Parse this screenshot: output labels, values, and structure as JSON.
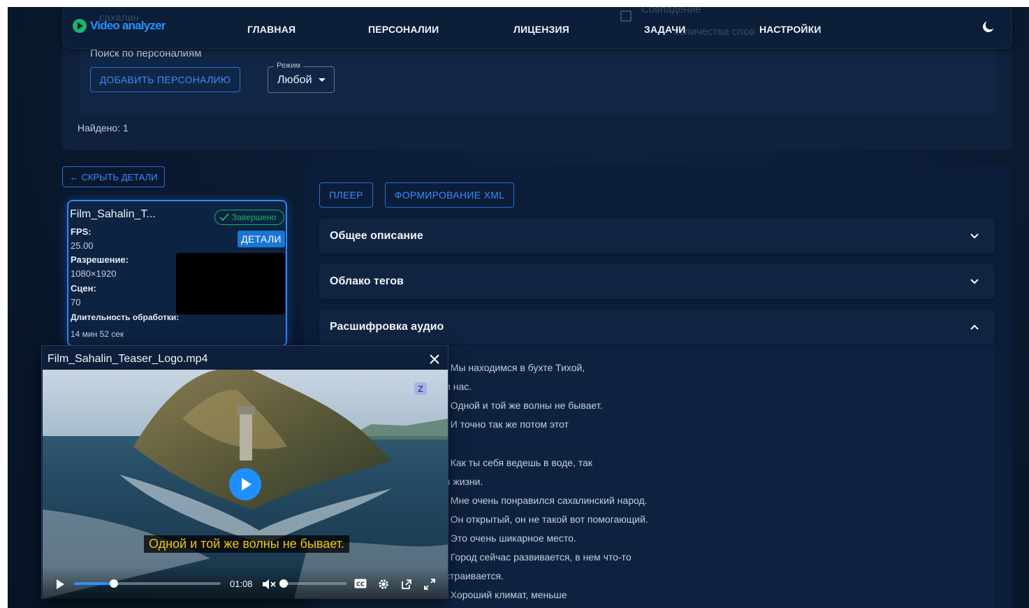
{
  "header": {
    "logo_text": "Video analyzer",
    "nav": [
      "ГЛАВНАЯ",
      "ПЕРСОНАЛИИ",
      "ЛИЦЕНЗИЯ",
      "ЗАДАЧИ",
      "НАСТРОЙКИ"
    ],
    "ghost_search_value": "сахалин",
    "ghost_checkbox_label_top": "Совпадение",
    "ghost_checkbox_label_bottom": "количества слов"
  },
  "search": {
    "label": "Поиск по персоналиям",
    "add_button": "ДОБАВИТЬ ПЕРСОНАЛИЮ",
    "mode_legend": "Режим",
    "mode_value": "Любой",
    "found": "Найдено: 1"
  },
  "hide_details": "СКРЫТЬ ДЕТАЛИ",
  "card": {
    "title": "Film_Sahalin_T...",
    "status": "Завершено",
    "details_button": "ДЕТАЛИ",
    "fps_label": "FPS:",
    "fps_value": "25.00",
    "resolution_label": "Разрешение:",
    "resolution_value": "1080×1920",
    "scenes_label": "Сцен:",
    "scenes_value": "70",
    "duration_label": "Длительность обработки:",
    "duration_value": "14 мин 52 сек"
  },
  "tabs": {
    "player": "ПЛЕЕР",
    "xml": "ФОРМИРОВАНИЕ XML"
  },
  "accordions": [
    {
      "title": "Общее описание",
      "expanded": false
    },
    {
      "title": "Облако тегов",
      "expanded": false
    },
    {
      "title": "Расшифровка аудио",
      "expanded": true
    }
  ],
  "transcript": [
    ": Мы находимся в бухте Тихой,",
    "и нас.",
    ": Одной и той же волны не бывает.",
    ": И точно так же потом этот",
    ": Как ты себя ведешь в воде, так",
    "в жизни.",
    ": Мне очень понравился сахалинский народ.",
    ": Он открытый, он не такой вот помогающий.",
    ": Это очень шикарное место.",
    ": Город сейчас развивается, в нем что-то",
    "страивается.",
    ": Хороший климат, меньше"
  ],
  "player": {
    "title": "Film_Sahalin_Teaser_Logo.mp4",
    "subtitle": "Одной и той же волны не бывает.",
    "time": "01:08",
    "progress_fraction": 0.27,
    "volume_fraction": 0.0,
    "badge": "Z"
  },
  "colors": {
    "accent": "#2b8fff",
    "success": "#19b66a",
    "subtitle": "#f4c20d"
  }
}
